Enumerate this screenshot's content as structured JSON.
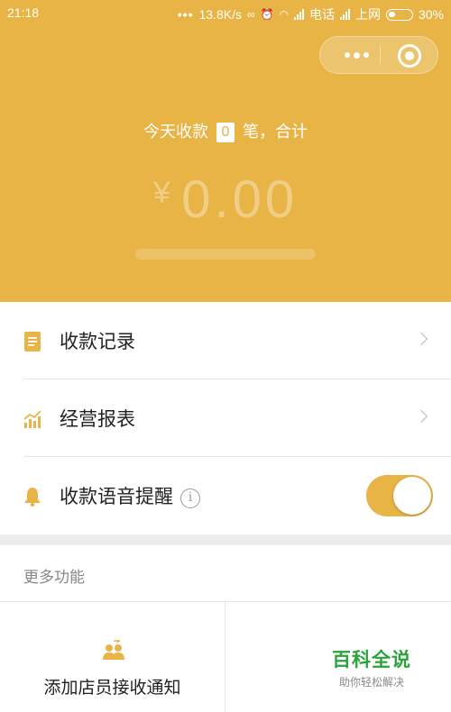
{
  "status_bar": {
    "time": "21:18",
    "dots": "•••",
    "speed": "13.8K/s",
    "carrier1": "电话",
    "carrier2": "上网",
    "battery": "30%"
  },
  "header": {
    "today_prefix": "今天收款",
    "today_count": "0",
    "today_suffix": "笔，合计",
    "currency": "¥",
    "amount": "0.00"
  },
  "menu": {
    "records_label": "收款记录",
    "reports_label": "经营报表",
    "voice_label": "收款语音提醒",
    "voice_info": "i",
    "voice_enabled": true
  },
  "more": {
    "title": "更多功能",
    "add_staff_label": "添加店员接收通知"
  },
  "watermark": {
    "title": "百科全说",
    "subtitle": "助你轻松解决"
  },
  "colors": {
    "accent": "#E8B446",
    "watermark_green": "#2BA33B"
  },
  "icons": [
    "document-icon",
    "bar-chart-icon",
    "bell-icon",
    "info-icon",
    "chevron-right-icon",
    "users-icon",
    "more-dots-icon",
    "close-target-icon"
  ]
}
